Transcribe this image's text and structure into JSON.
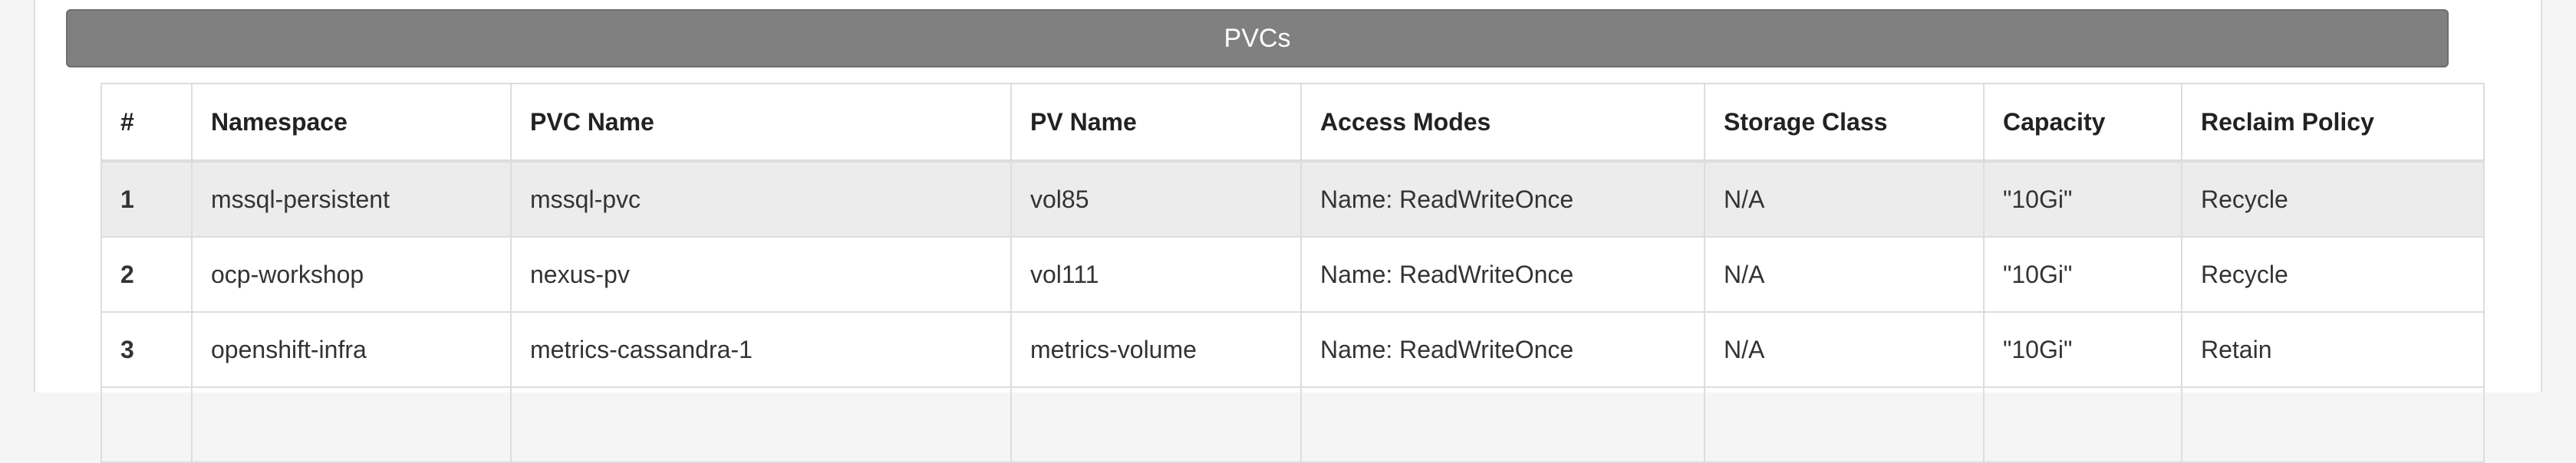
{
  "section": {
    "title": "PVCs"
  },
  "table": {
    "columns": [
      "#",
      "Namespace",
      "PVC Name",
      "PV Name",
      "Access Modes",
      "Storage Class",
      "Capacity",
      "Reclaim Policy"
    ],
    "rows": [
      [
        "1",
        "mssql-persistent",
        "mssql-pvc",
        "vol85",
        "Name: ReadWriteOnce",
        "N/A",
        "\"10Gi\"",
        "Recycle"
      ],
      [
        "2",
        "ocp-workshop",
        "nexus-pv",
        "vol111",
        "Name: ReadWriteOnce",
        "N/A",
        "\"10Gi\"",
        "Recycle"
      ],
      [
        "3",
        "openshift-infra",
        "metrics-cassandra-1",
        "metrics-volume",
        "Name: ReadWriteOnce",
        "N/A",
        "\"10Gi\"",
        "Retain"
      ]
    ]
  }
}
